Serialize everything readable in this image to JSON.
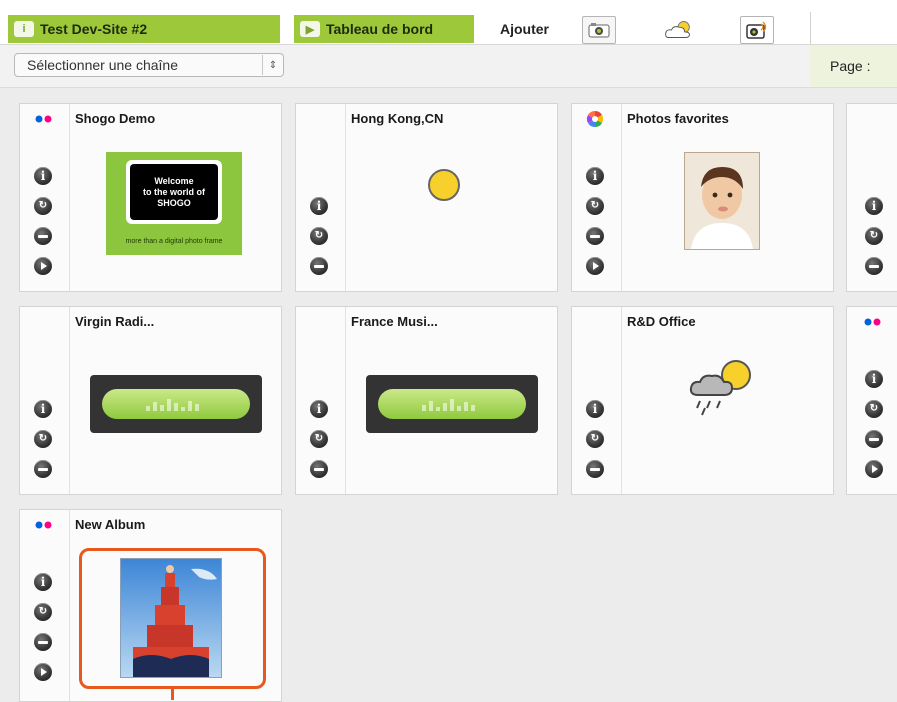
{
  "header": {
    "site_tab": "Test Dev-Site #2",
    "dashboard_tab": "Tableau de bord",
    "add_label": "Ajouter",
    "add_buttons": [
      "camera-icon",
      "weather-cloud-icon",
      "radio-icon"
    ]
  },
  "toolbar": {
    "channel_select": "Sélectionner une chaîne",
    "page_label": "Page :"
  },
  "tiles": [
    {
      "title": "Shogo Demo",
      "source": "flickr",
      "controls": [
        "info",
        "refresh",
        "minus",
        "play"
      ],
      "image": {
        "line1": "Welcome",
        "line2": "to the world of",
        "line3": "SHOGO",
        "tagline": "more than a digital photo frame"
      }
    },
    {
      "title": "Hong Kong,CN",
      "source": "",
      "controls": [
        "info",
        "refresh",
        "minus"
      ],
      "image": "sun-icon"
    },
    {
      "title": "Photos favorites",
      "source": "picasa",
      "controls": [
        "info",
        "refresh",
        "minus",
        "play"
      ],
      "image": "child-photo"
    },
    {
      "title": "Virgin Radi...",
      "source": "",
      "controls": [
        "info",
        "refresh",
        "minus"
      ],
      "image": "radio-display"
    },
    {
      "title": "France Musi...",
      "source": "",
      "controls": [
        "info",
        "refresh",
        "minus"
      ],
      "image": "radio-display"
    },
    {
      "title": "R&D Office",
      "source": "",
      "controls": [
        "info",
        "refresh",
        "minus"
      ],
      "image": "sun-cloud-rain-icon"
    },
    {
      "title": "New Album",
      "source": "flickr",
      "controls": [
        "info",
        "refresh",
        "minus",
        "play"
      ],
      "image": "human-tower-photo"
    }
  ],
  "colors": {
    "accent_green": "#9cc83a",
    "highlight_orange": "#e8571d",
    "flickr_blue": "#0063dc",
    "flickr_pink": "#ff0084"
  }
}
